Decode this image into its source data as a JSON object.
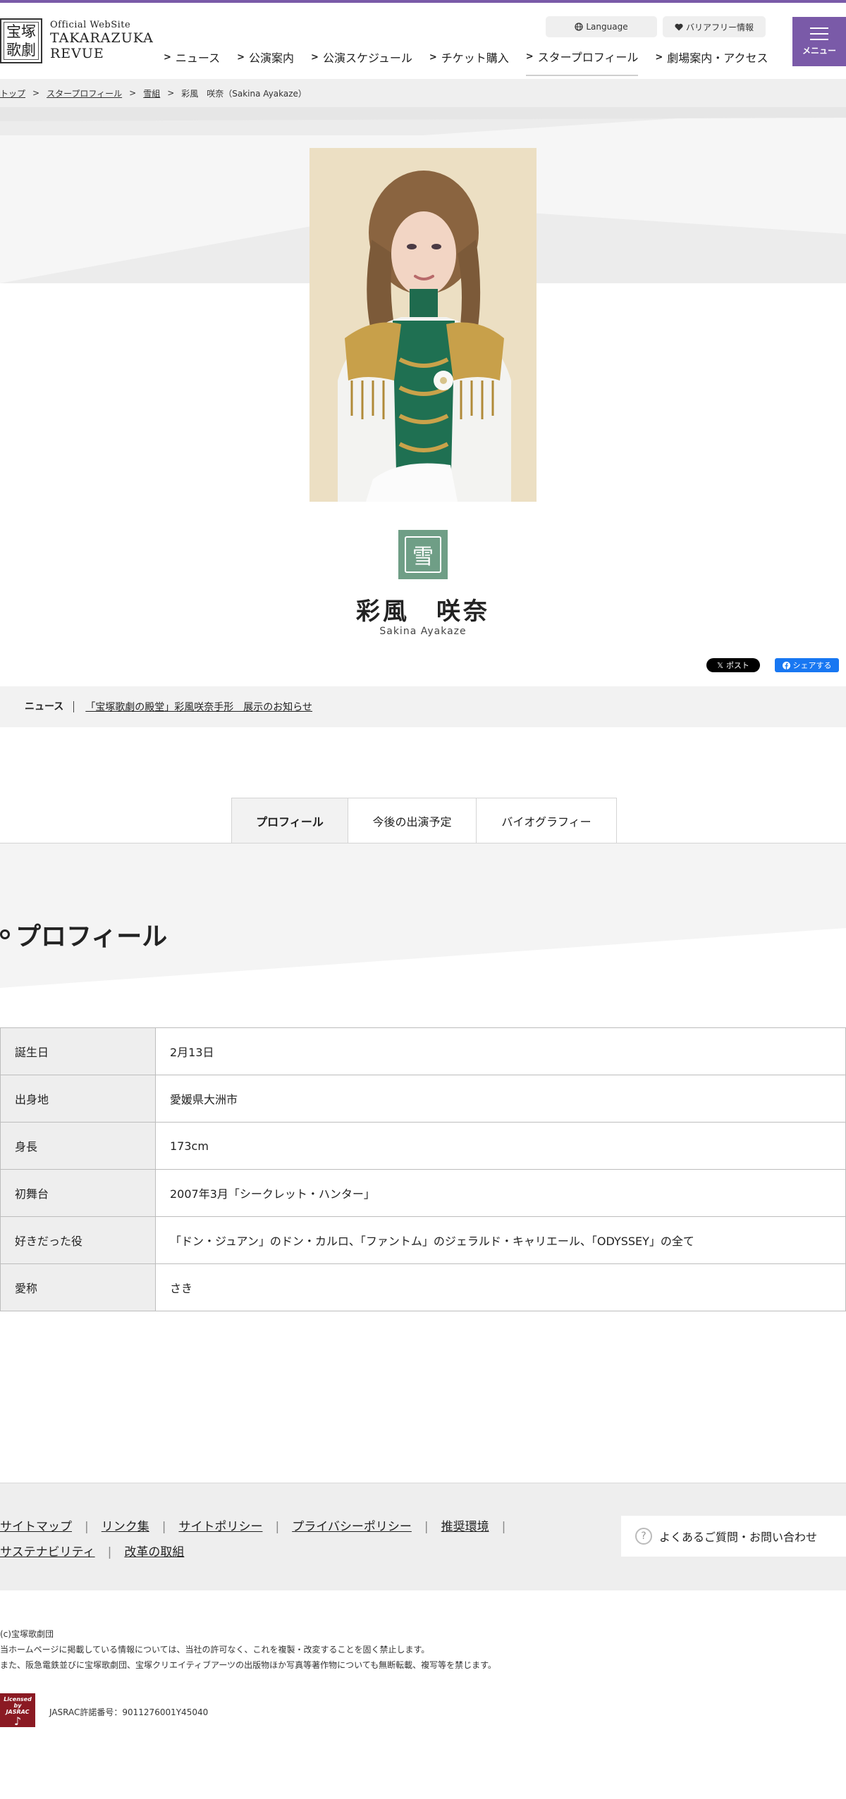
{
  "header": {
    "logo_kanji_1": "宝塚",
    "logo_kanji_2": "歌劇",
    "logo_small": "Official WebSite",
    "logo_big_1": "TAKARAZUKA",
    "logo_big_2": "REVUE",
    "language": "Language",
    "barrier_free": "バリアフリー情報",
    "menu_label": "メニュー",
    "nav": [
      "ニュース",
      "公演案内",
      "公演スケジュール",
      "チケット購入",
      "スタープロフィール",
      "劇場案内・アクセス"
    ]
  },
  "breadcrumb": [
    "トップ",
    "スタープロフィール",
    "雪組",
    "彩風　咲奈（Sakina Ayakaze）"
  ],
  "star": {
    "name": "彩風　咲奈",
    "roman": "Sakina Ayakaze",
    "emblem_glyph": "雪"
  },
  "share": {
    "x_label": "ポスト",
    "fb_label": "シェアする"
  },
  "news": {
    "label": "ニュース",
    "link": "「宝塚歌劇の殿堂」彩風咲奈手形　展示のお知らせ"
  },
  "tabs": [
    "プロフィール",
    "今後の出演予定",
    "バイオグラフィー"
  ],
  "profile": {
    "title": "プロフィール",
    "rows": [
      {
        "label": "誕生日",
        "value": "2月13日"
      },
      {
        "label": "出身地",
        "value": "愛媛県大洲市"
      },
      {
        "label": "身長",
        "value": "173cm"
      },
      {
        "label": "初舞台",
        "value": "2007年3月「シークレット・ハンター」"
      },
      {
        "label": "好きだった役",
        "value": "「ドン・ジュアン」のドン・カルロ、「ファントム」のジェラルド・キャリエール、「ODYSSEY」の全て"
      },
      {
        "label": "愛称",
        "value": "さき"
      }
    ]
  },
  "footer": {
    "links_row1": [
      "サイトマップ",
      "リンク集",
      "サイトポリシー",
      "プライバシーポリシー",
      "推奨環境"
    ],
    "links_row2": [
      "サステナビリティ",
      "改革の取組"
    ],
    "faq": "よくあるご質問・お問い合わせ",
    "faq_icon": "?",
    "copyright": "(c)宝塚歌劇団",
    "notice_1": "当ホームページに掲載している情報については、当社の許可なく、これを複製・改変することを固く禁止します。",
    "notice_2": "また、阪急電鉄並びに宝塚歌劇団、宝塚クリエイティブアーツの出版物ほか写真等著作物についても無断転載、複写等を禁じます。",
    "jasrac_badge_1": "Licensed",
    "jasrac_badge_2": "by",
    "jasrac_badge_3": "JASRAC",
    "jasrac_number": "JASRAC許諾番号：9011276001Y45040"
  },
  "colors": {
    "accent": "#7a5aa8",
    "emblem": "#6f9e86",
    "fb": "#1877f2"
  }
}
